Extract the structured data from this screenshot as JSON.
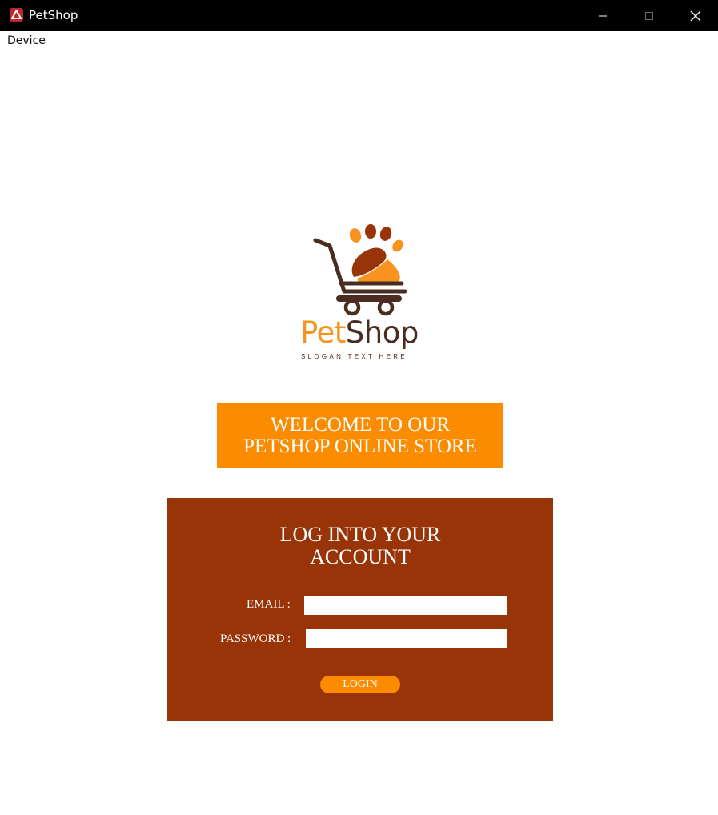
{
  "window": {
    "title": "PetShop",
    "icon": "app-logo-icon",
    "controls": [
      "minimize-icon",
      "maximize-icon",
      "close-icon"
    ]
  },
  "menubar": {
    "items": [
      {
        "label": "Device"
      }
    ]
  },
  "logo": {
    "word_part1": "Pet",
    "word_part2": "Shop",
    "slogan": "SLOGAN TEXT HERE",
    "icon": "paw-cart-icon"
  },
  "welcome": {
    "line1": "WELCOME TO OUR",
    "line2": "PETSHOP ONLINE STORE"
  },
  "login": {
    "heading_line1": "LOG INTO YOUR",
    "heading_line2": "ACCOUNT",
    "email_label": "EMAIL :",
    "email_value": "",
    "password_label": "PASSWORD :",
    "password_value": "",
    "button_label": "LOGIN"
  },
  "colors": {
    "titlebar": "#000000",
    "accent_orange": "#fb8c00",
    "panel_brown": "#993308",
    "logo_dark": "#4a2c20"
  }
}
